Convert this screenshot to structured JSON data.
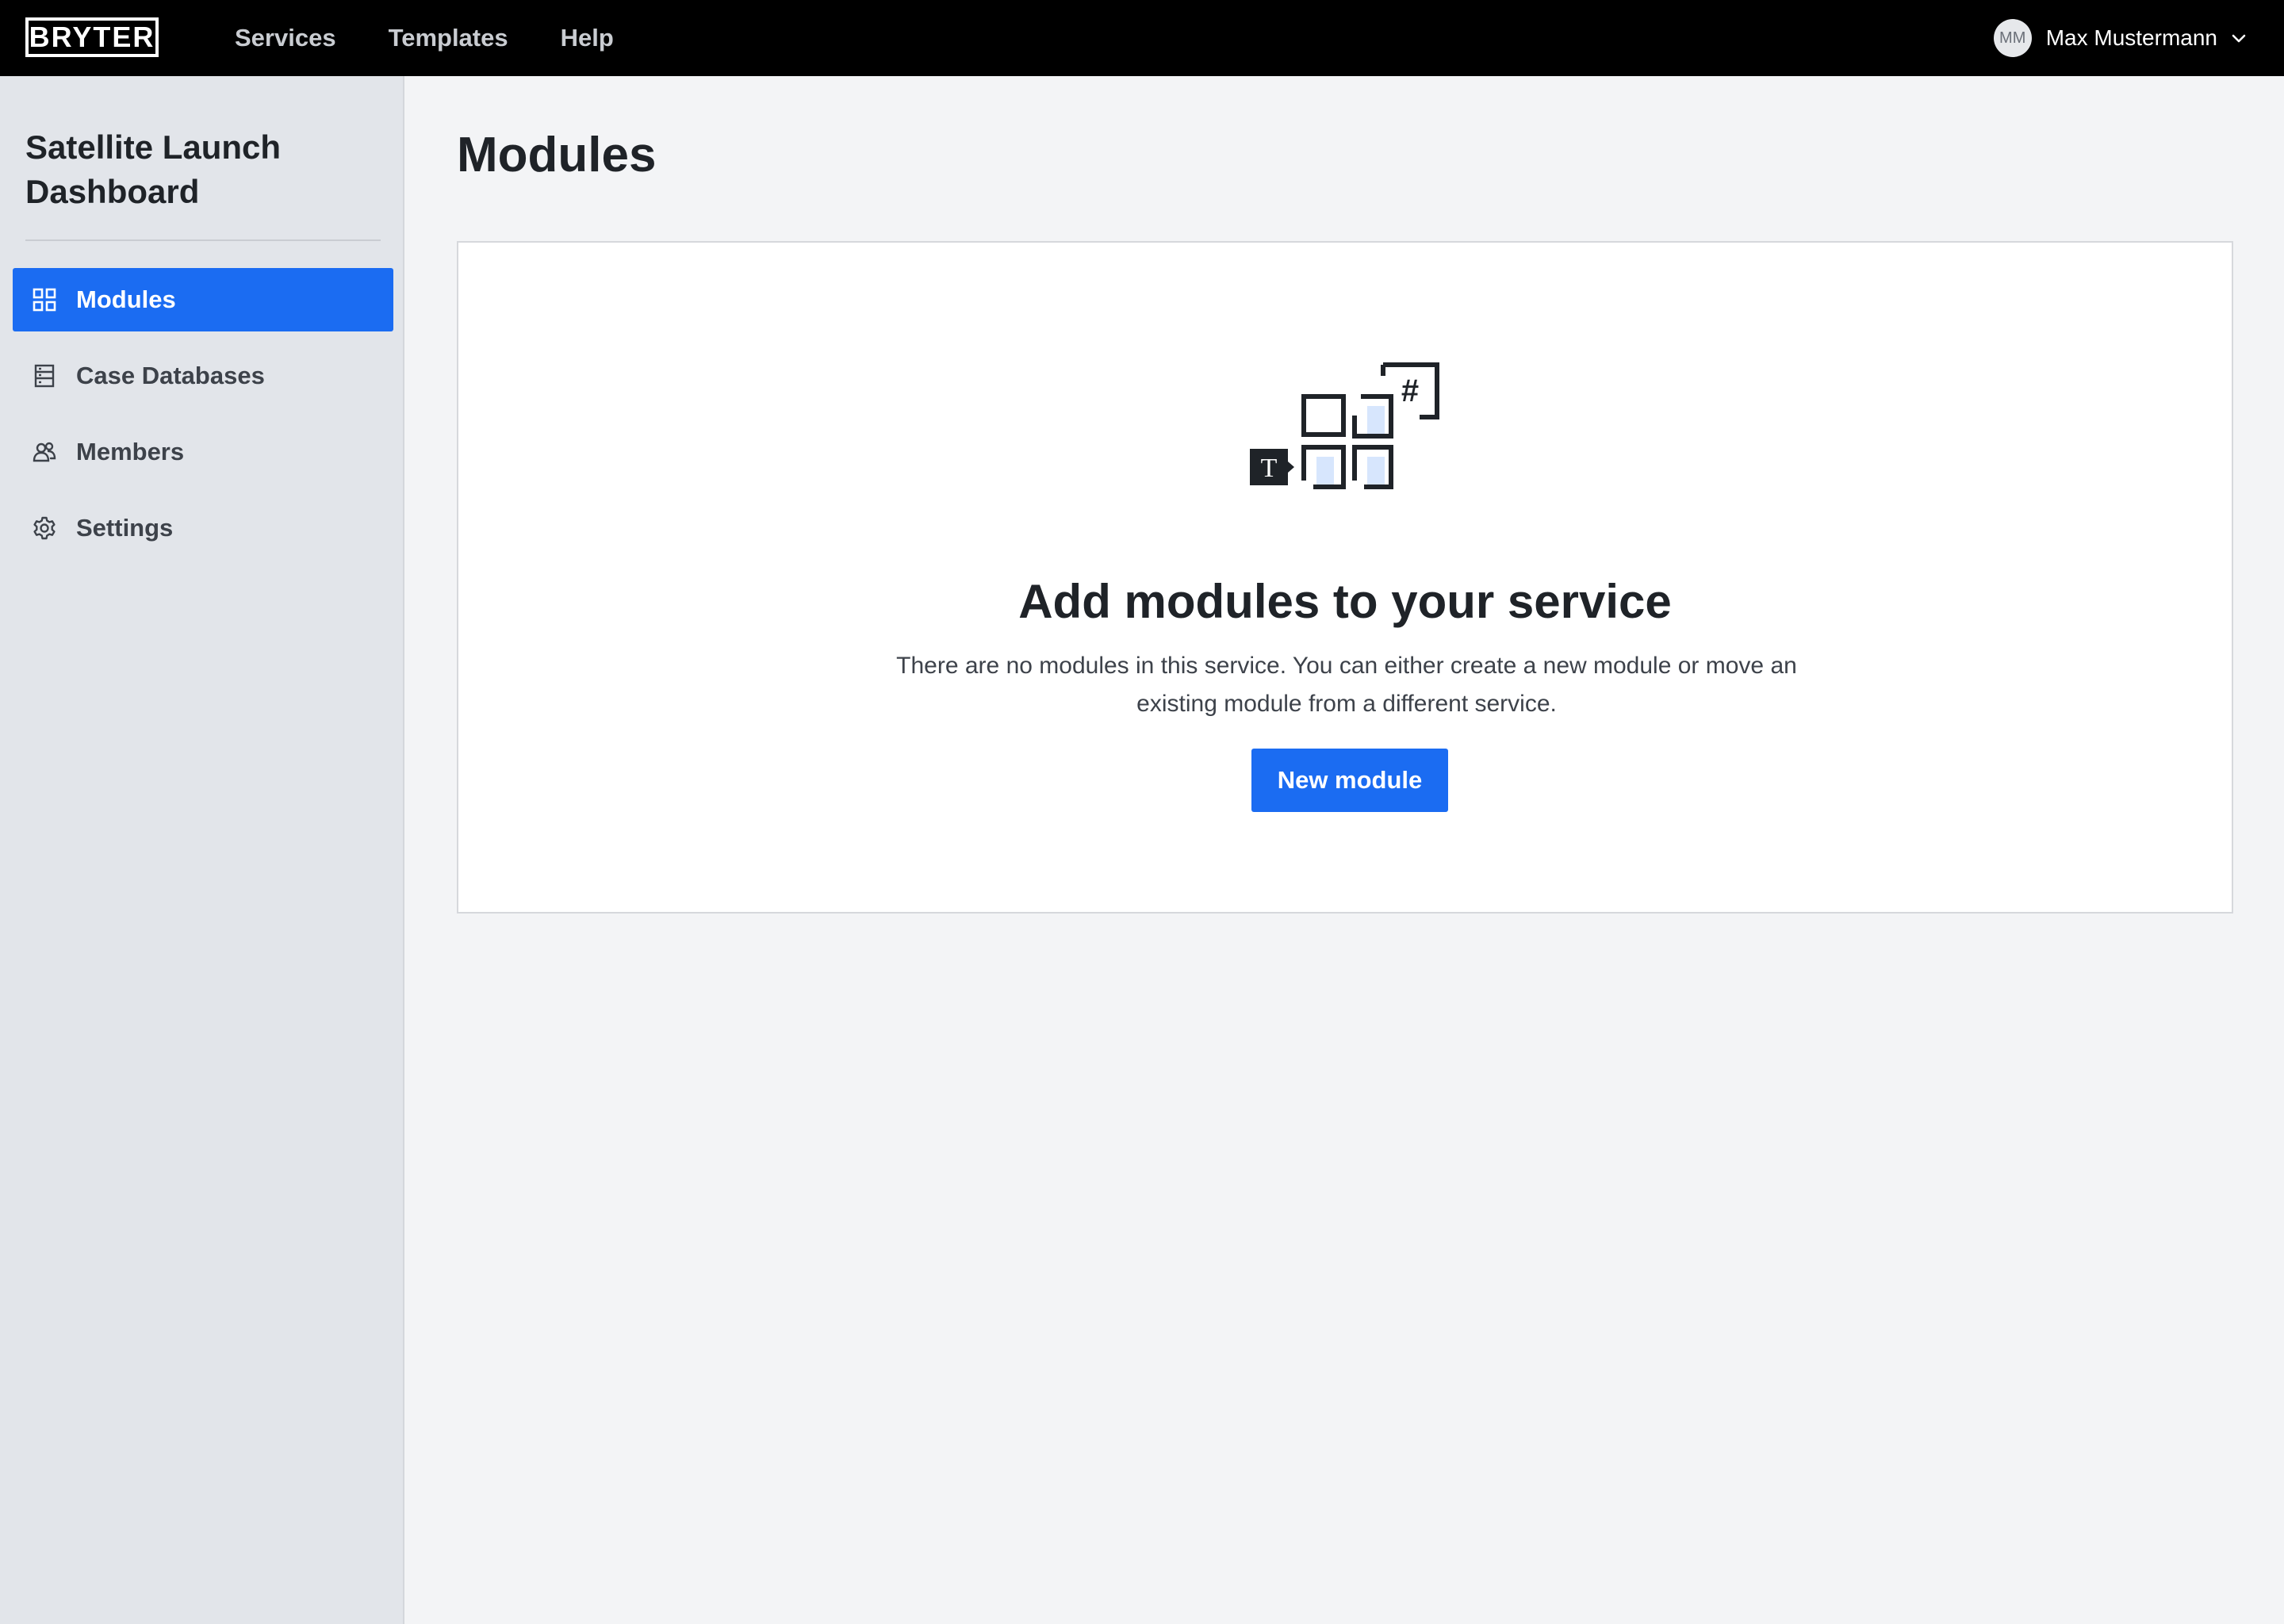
{
  "brand": {
    "logo_text": "BRYTER"
  },
  "topnav": {
    "items": [
      {
        "label": "Services"
      },
      {
        "label": "Templates"
      },
      {
        "label": "Help"
      }
    ]
  },
  "user": {
    "initials": "MM",
    "name": "Max Mustermann"
  },
  "sidebar": {
    "service_title": "Satellite Launch Dashboard",
    "items": [
      {
        "label": "Modules",
        "icon": "grid-icon",
        "active": true
      },
      {
        "label": "Case Databases",
        "icon": "database-icon",
        "active": false
      },
      {
        "label": "Members",
        "icon": "members-icon",
        "active": false
      },
      {
        "label": "Settings",
        "icon": "gear-icon",
        "active": false
      }
    ]
  },
  "main": {
    "title": "Modules",
    "empty_state": {
      "title": "Add modules to your service",
      "description": "There are no modules in this service. You can either create a new module or move an existing module from a different service.",
      "button_label": "New module",
      "illustration_glyphs": {
        "text": "T",
        "number": "#"
      }
    }
  },
  "colors": {
    "accent": "#1b6cf2",
    "topbar_bg": "#000000",
    "sidebar_bg": "#e2e5ea",
    "page_bg": "#f3f4f6",
    "illustration_fill": "#d7e6fd"
  }
}
